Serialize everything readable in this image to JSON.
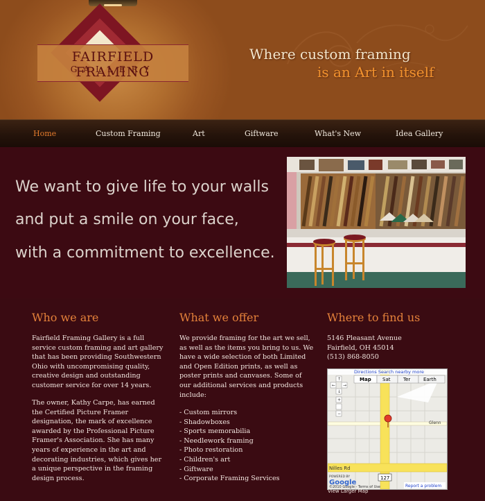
{
  "header": {
    "logo_line1": "FAIRFIELD FRAMING",
    "logo_line2": "GALLERY",
    "tagline_line1": "Where custom framing",
    "tagline_line2": "is an Art in itself"
  },
  "nav": {
    "items": [
      {
        "label": "Home",
        "active": true
      },
      {
        "label": "Custom Framing"
      },
      {
        "label": "Art"
      },
      {
        "label": "Giftware"
      },
      {
        "label": "What's New"
      },
      {
        "label": "Idea Gallery"
      }
    ]
  },
  "hero": {
    "line1": "We want to give life to your walls",
    "line2": "and put a smile on your face,",
    "line3": "with a commitment to excellence."
  },
  "who": {
    "heading": "Who we are",
    "p1": [
      "Fairfield Framing Gallery is a full",
      "service custom framing and art gallery",
      "that has been providing Southwestern",
      "Ohio with uncompromising quality,",
      "creative design and outstanding",
      "customer service for over 14 years."
    ],
    "p2": [
      "The owner, Kathy Carpe, has earned",
      "the Certified Picture Framer",
      "designation, the mark of excellence",
      "awarded by the Professional Picture",
      "Framer's Association. She has many",
      "years of experience in the art and",
      "decorating industries, which gives her",
      "a unique perspective in the framing",
      "design process."
    ]
  },
  "offer": {
    "heading": "What we offer",
    "p1": [
      "We provide framing for the art we sell,",
      "as well as the items you bring to us. We",
      "have a wide selection of both Limited",
      "and Open Edition prints, as well as",
      "poster prints and canvases. Some of",
      "our additional services and products",
      "include:"
    ],
    "list": [
      "- Custom mirrors",
      "- Shadowboxes",
      "- Sports memorabilia",
      "- Needlework framing",
      "- Photo restoration",
      "- Children's art",
      "- Giftware",
      "- Corporate Framing Services"
    ]
  },
  "find": {
    "heading": "Where to find us",
    "address": [
      "5146 Pleasant Avenue",
      "Fairfield, OH 45014",
      "(513) 868-8050"
    ],
    "map": {
      "top_links": "Directions  Search nearby  more",
      "types": [
        "Map",
        "Sat",
        "Ter",
        "Earth"
      ],
      "street1": "Glenn",
      "street2": "Nilles Rd",
      "route": "127",
      "powered": "POWERED BY",
      "google": "Google",
      "copyright": "©2010 Google - Terms of Use",
      "report": "Report a problem",
      "larger": "View Larger Map"
    }
  },
  "colors": {
    "background": "#3a0b12",
    "accent": "#e4813a",
    "header": "#b06d2e"
  }
}
